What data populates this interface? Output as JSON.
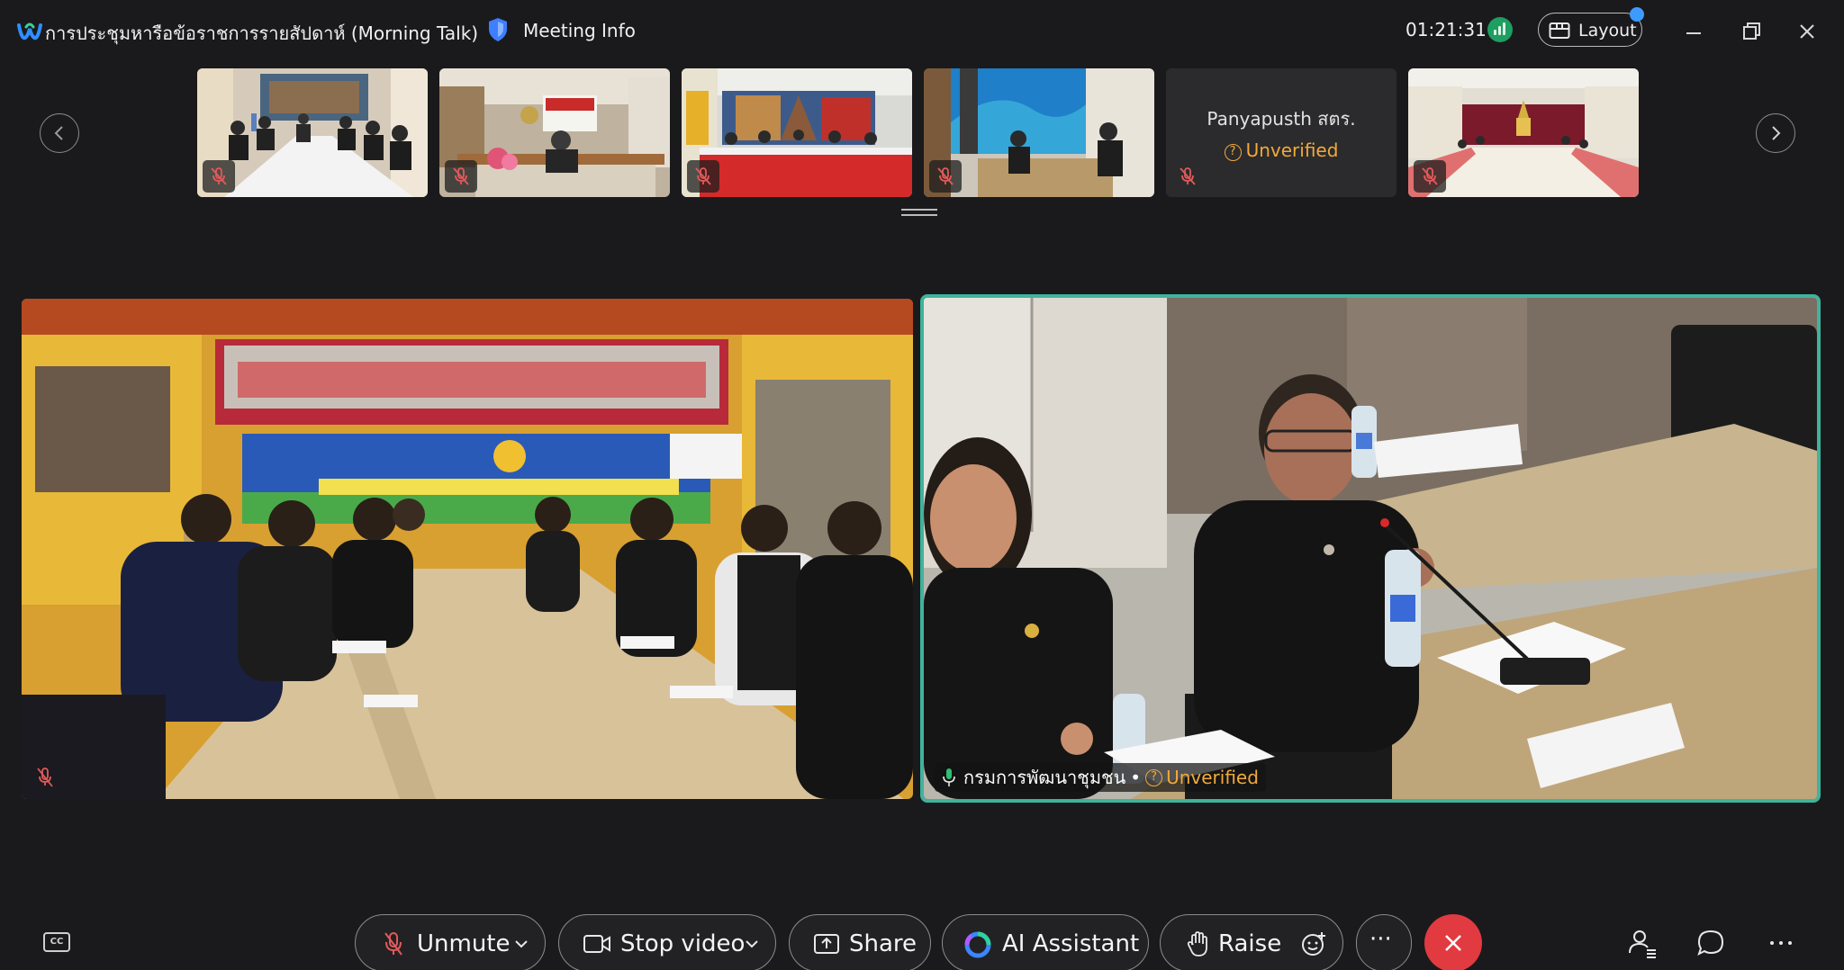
{
  "titlebar": {
    "meeting_title": "การประชุมหารือข้อราชการรายสัปดาห์ (Morning Talk)",
    "meeting_info_label": "Meeting Info",
    "elapsed_time": "01:21:31",
    "layout_label": "Layout"
  },
  "thumbnails": [
    {
      "type": "video",
      "muted": true
    },
    {
      "type": "video",
      "muted": true
    },
    {
      "type": "video",
      "muted": true
    },
    {
      "type": "video",
      "muted": true
    },
    {
      "type": "name",
      "name": "Panyapusth สตร.",
      "status": "Unverified",
      "muted": true
    },
    {
      "type": "video",
      "muted": true
    }
  ],
  "main_videos": {
    "left": {
      "muted": true
    },
    "right": {
      "name": "กรมการพัฒนาชุมชน",
      "status": "Unverified",
      "separator": "•",
      "active_speaker": true
    }
  },
  "controls": {
    "unmute_label": "Unmute",
    "stop_video_label": "Stop video",
    "share_label": "Share",
    "ai_assistant_label": "AI Assistant",
    "raise_label": "Raise",
    "more_label": "···",
    "cc_label": "CC"
  },
  "colors": {
    "accent_active": "#3fb39b",
    "unverified": "#f2a93a",
    "end_call": "#e23a41",
    "notification_dot": "#3d9bff"
  }
}
